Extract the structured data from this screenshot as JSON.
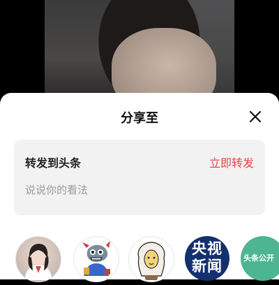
{
  "share_sheet": {
    "title": "分享至",
    "repost": {
      "title": "转发到头条",
      "action_label": "立即转发",
      "placeholder": "说说你的看法"
    },
    "contacts": [
      {
        "avatar": "woman-doctor-avatar"
      },
      {
        "avatar": "cartoon-fish-avatar"
      },
      {
        "avatar": "cartoon-scientist-avatar"
      },
      {
        "avatar": "cctv-news-logo",
        "text": "央视新闻"
      },
      {
        "avatar": "toutiao-logo",
        "text": "头条公开"
      }
    ]
  },
  "colors": {
    "accent": "#f04142",
    "card_bg": "#f2f2f2",
    "cctv_blue": "#13306f",
    "toutiao_green": "#4db592"
  }
}
